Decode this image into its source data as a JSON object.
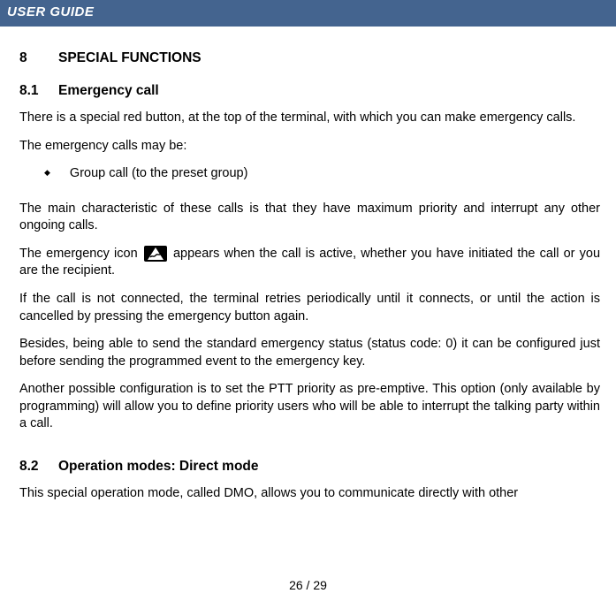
{
  "header": {
    "title": "USER GUIDE"
  },
  "section8": {
    "num": "8",
    "title": "SPECIAL FUNCTIONS"
  },
  "section8_1": {
    "num": "8.1",
    "title": "Emergency call",
    "p1": "There is a special red button, at the top of the terminal, with which you can make emergency calls.",
    "p2": "The emergency calls may be:",
    "bullet1": "Group call (to the preset group)",
    "p3": "The main characteristic of these calls is that they have maximum priority and interrupt any other ongoing calls.",
    "p4a": "The emergency icon ",
    "p4b": " appears when the call is active, whether you have initiated the call or you are the recipient.",
    "p5": "If the call is not connected, the terminal retries periodically until it connects, or until the action is cancelled by pressing the emergency button again.",
    "p6": "Besides, being able to send the standard emergency status (status code: 0) it can be configured just before sending the programmed event to the emergency key.",
    "p7": "Another possible configuration is to set the PTT priority as pre-emptive. This option (only available by programming) will allow you to define priority users who will be able to interrupt the talking party within a call."
  },
  "section8_2": {
    "num": "8.2",
    "title": "Operation modes: Direct mode",
    "p1": "This special operation mode, called DMO, allows you to communicate directly with other"
  },
  "footer": {
    "page": "26 / 29"
  }
}
